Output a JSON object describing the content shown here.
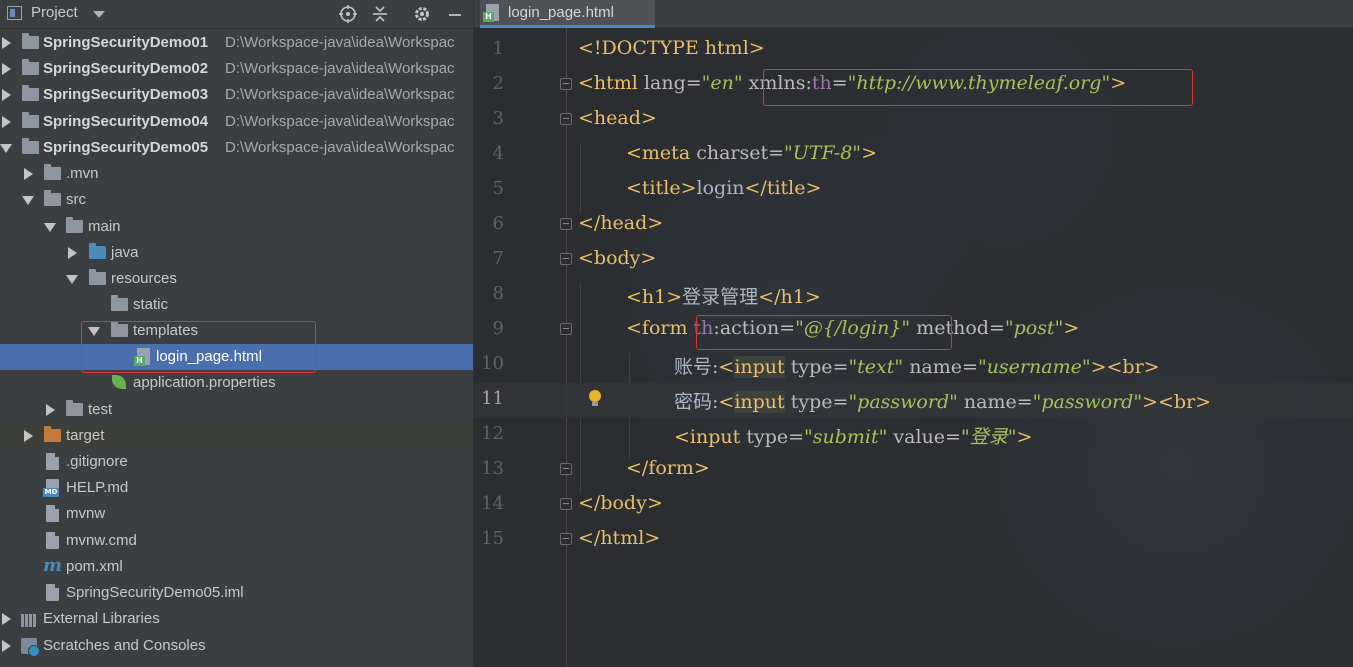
{
  "project_panel": {
    "title": "Project",
    "tree": [
      {
        "label": "SpringSecurityDemo01",
        "path": "D:\\Workspace-java\\idea\\Workspac"
      },
      {
        "label": "SpringSecurityDemo02",
        "path": "D:\\Workspace-java\\idea\\Workspac"
      },
      {
        "label": "SpringSecurityDemo03",
        "path": "D:\\Workspace-java\\idea\\Workspac"
      },
      {
        "label": "SpringSecurityDemo04",
        "path": "D:\\Workspace-java\\idea\\Workspac"
      },
      {
        "label": "SpringSecurityDemo05",
        "path": "D:\\Workspace-java\\idea\\Workspac"
      },
      {
        "label": ".mvn"
      },
      {
        "label": "src"
      },
      {
        "label": "main"
      },
      {
        "label": "java"
      },
      {
        "label": "resources"
      },
      {
        "label": "static"
      },
      {
        "label": "templates"
      },
      {
        "label": "login_page.html"
      },
      {
        "label": "application.properties"
      },
      {
        "label": "test"
      },
      {
        "label": "target"
      },
      {
        "label": ".gitignore"
      },
      {
        "label": "HELP.md"
      },
      {
        "label": "mvnw"
      },
      {
        "label": "mvnw.cmd"
      },
      {
        "label": "pom.xml"
      },
      {
        "label": "SpringSecurityDemo05.iml"
      },
      {
        "label": "External Libraries"
      },
      {
        "label": "Scratches and Consoles"
      }
    ]
  },
  "editor": {
    "tab_label": "login_page.html",
    "line_numbers": [
      "1",
      "2",
      "3",
      "4",
      "5",
      "6",
      "7",
      "8",
      "9",
      "10",
      "11",
      "12",
      "13",
      "14",
      "15"
    ],
    "lines": {
      "l1": {
        "a": "<!DOCTYPE html>"
      },
      "l2": {
        "a": "<html",
        "b": " lang=",
        "c": "\"en\"",
        "d": " ",
        "e": "xmlns:",
        "f": "th",
        "g": "=",
        "h": "\"http://www.thymeleaf.org\"",
        "i": ">"
      },
      "l3": {
        "a": "<head>"
      },
      "l4": {
        "a": "<meta",
        "b": " charset=",
        "c": "\"UTF-8\"",
        "d": ">"
      },
      "l5": {
        "a": "<title>",
        "b": "login",
        "c": "</title>"
      },
      "l6": {
        "a": "</head>"
      },
      "l7": {
        "a": "<body>"
      },
      "l8": {
        "a": "<h1>",
        "b": "登录管理",
        "c": "</h1>"
      },
      "l9": {
        "a": "<form",
        "b": " ",
        "c": "th",
        "d": ":action=",
        "e": "\"@{/login}\"",
        "f": " method=",
        "g": "\"post\"",
        "h": ">"
      },
      "l10": {
        "a": "账号:",
        "b": "<",
        "c": "input",
        "d": " type=",
        "e": "\"text\"",
        "f": " name=",
        "g": "\"username\"",
        "h": "><br>"
      },
      "l11": {
        "a": "密码:",
        "b": "<",
        "c": "input",
        "d": " type=",
        "e": "\"password\"",
        "f": " name=",
        "g": "\"password\"",
        "h": "><br>"
      },
      "l12": {
        "a": "<input",
        "b": " type=",
        "c": "\"submit\"",
        "d": " value=",
        "e": "\"登录\"",
        "f": ">"
      },
      "l13": {
        "a": "</form>"
      },
      "l14": {
        "a": "</body>"
      },
      "l15": {
        "a": "</html>"
      }
    }
  },
  "colors": {
    "tag": "#e8bf6a",
    "attribute": "#bababa",
    "value": "#a5c25c",
    "namespace": "#9876aa",
    "selection": "#4b6eaf",
    "highlight_box": "#e03232"
  }
}
